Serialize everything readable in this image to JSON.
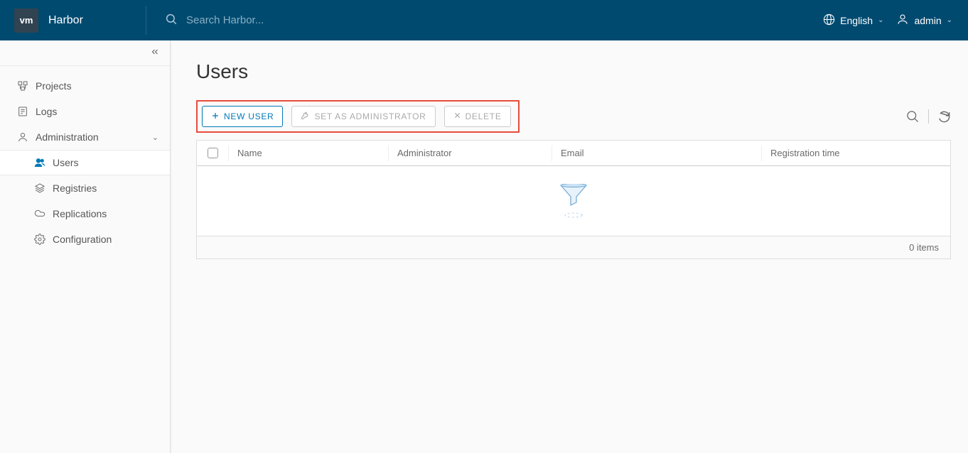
{
  "header": {
    "logo_text": "vm",
    "app_name": "Harbor",
    "search_placeholder": "Search Harbor...",
    "language_label": "English",
    "user_label": "admin"
  },
  "sidebar": {
    "items": {
      "projects": "Projects",
      "logs": "Logs",
      "administration": "Administration",
      "users": "Users",
      "registries": "Registries",
      "replications": "Replications",
      "configuration": "Configuration"
    }
  },
  "page": {
    "title": "Users"
  },
  "toolbar": {
    "new_user": "NEW USER",
    "set_admin": "SET AS ADMINISTRATOR",
    "delete": "DELETE"
  },
  "table": {
    "headers": {
      "name": "Name",
      "administrator": "Administrator",
      "email": "Email",
      "registration_time": "Registration time"
    },
    "rows": [],
    "footer_text": "0 items"
  }
}
